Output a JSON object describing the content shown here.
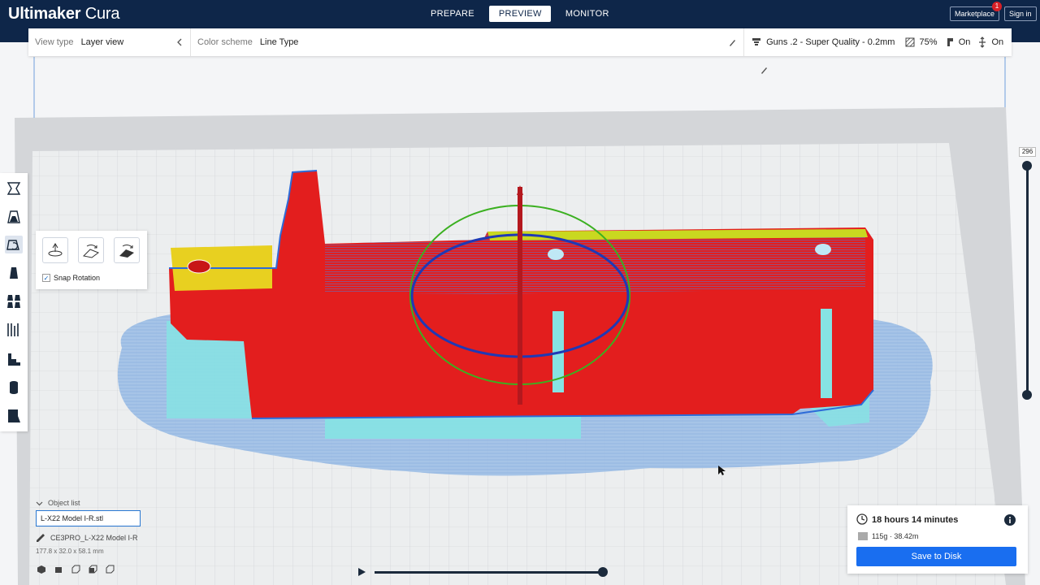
{
  "app": {
    "name_bold": "Ultimaker",
    "name_light": " Cura"
  },
  "header": {
    "tabs": [
      {
        "label": "PREPARE",
        "active": false
      },
      {
        "label": "PREVIEW",
        "active": true
      },
      {
        "label": "MONITOR",
        "active": false
      }
    ],
    "marketplace_label": "Marketplace",
    "marketplace_badge": "1",
    "signin_label": "Sign in"
  },
  "settings_bar": {
    "view_type_label": "View type",
    "view_type_value": "Layer view",
    "color_scheme_label": "Color scheme",
    "color_scheme_value": "Line Type",
    "profile": "Guns .2 - Super Quality - 0.2mm",
    "infill": "75%",
    "support": "On",
    "adhesion": "On"
  },
  "rotate_panel": {
    "snap_label": "Snap Rotation",
    "snap_checked": true
  },
  "layer_slider": {
    "value": "296",
    "max_fraction": 1.0
  },
  "path_slider": {
    "fraction": 1.0
  },
  "object_list": {
    "header": "Object list",
    "selected": "L-X22 Model I-R.stl",
    "job_name": "CE3PRO_L-X22 Model I-R",
    "dimensions": "177.8 x 32.0 x 58.1 mm"
  },
  "print_info": {
    "time": "18 hours 14 minutes",
    "material": "115g · 38.42m",
    "save_label": "Save to Disk"
  },
  "colors": {
    "header_bg": "#0e2649",
    "accent_blue": "#196ef0",
    "wall_red": "#e02020",
    "support_cyan": "#7fe0e0",
    "skirt_blue": "#7ca8da",
    "infill_yellow": "#e8d020"
  }
}
